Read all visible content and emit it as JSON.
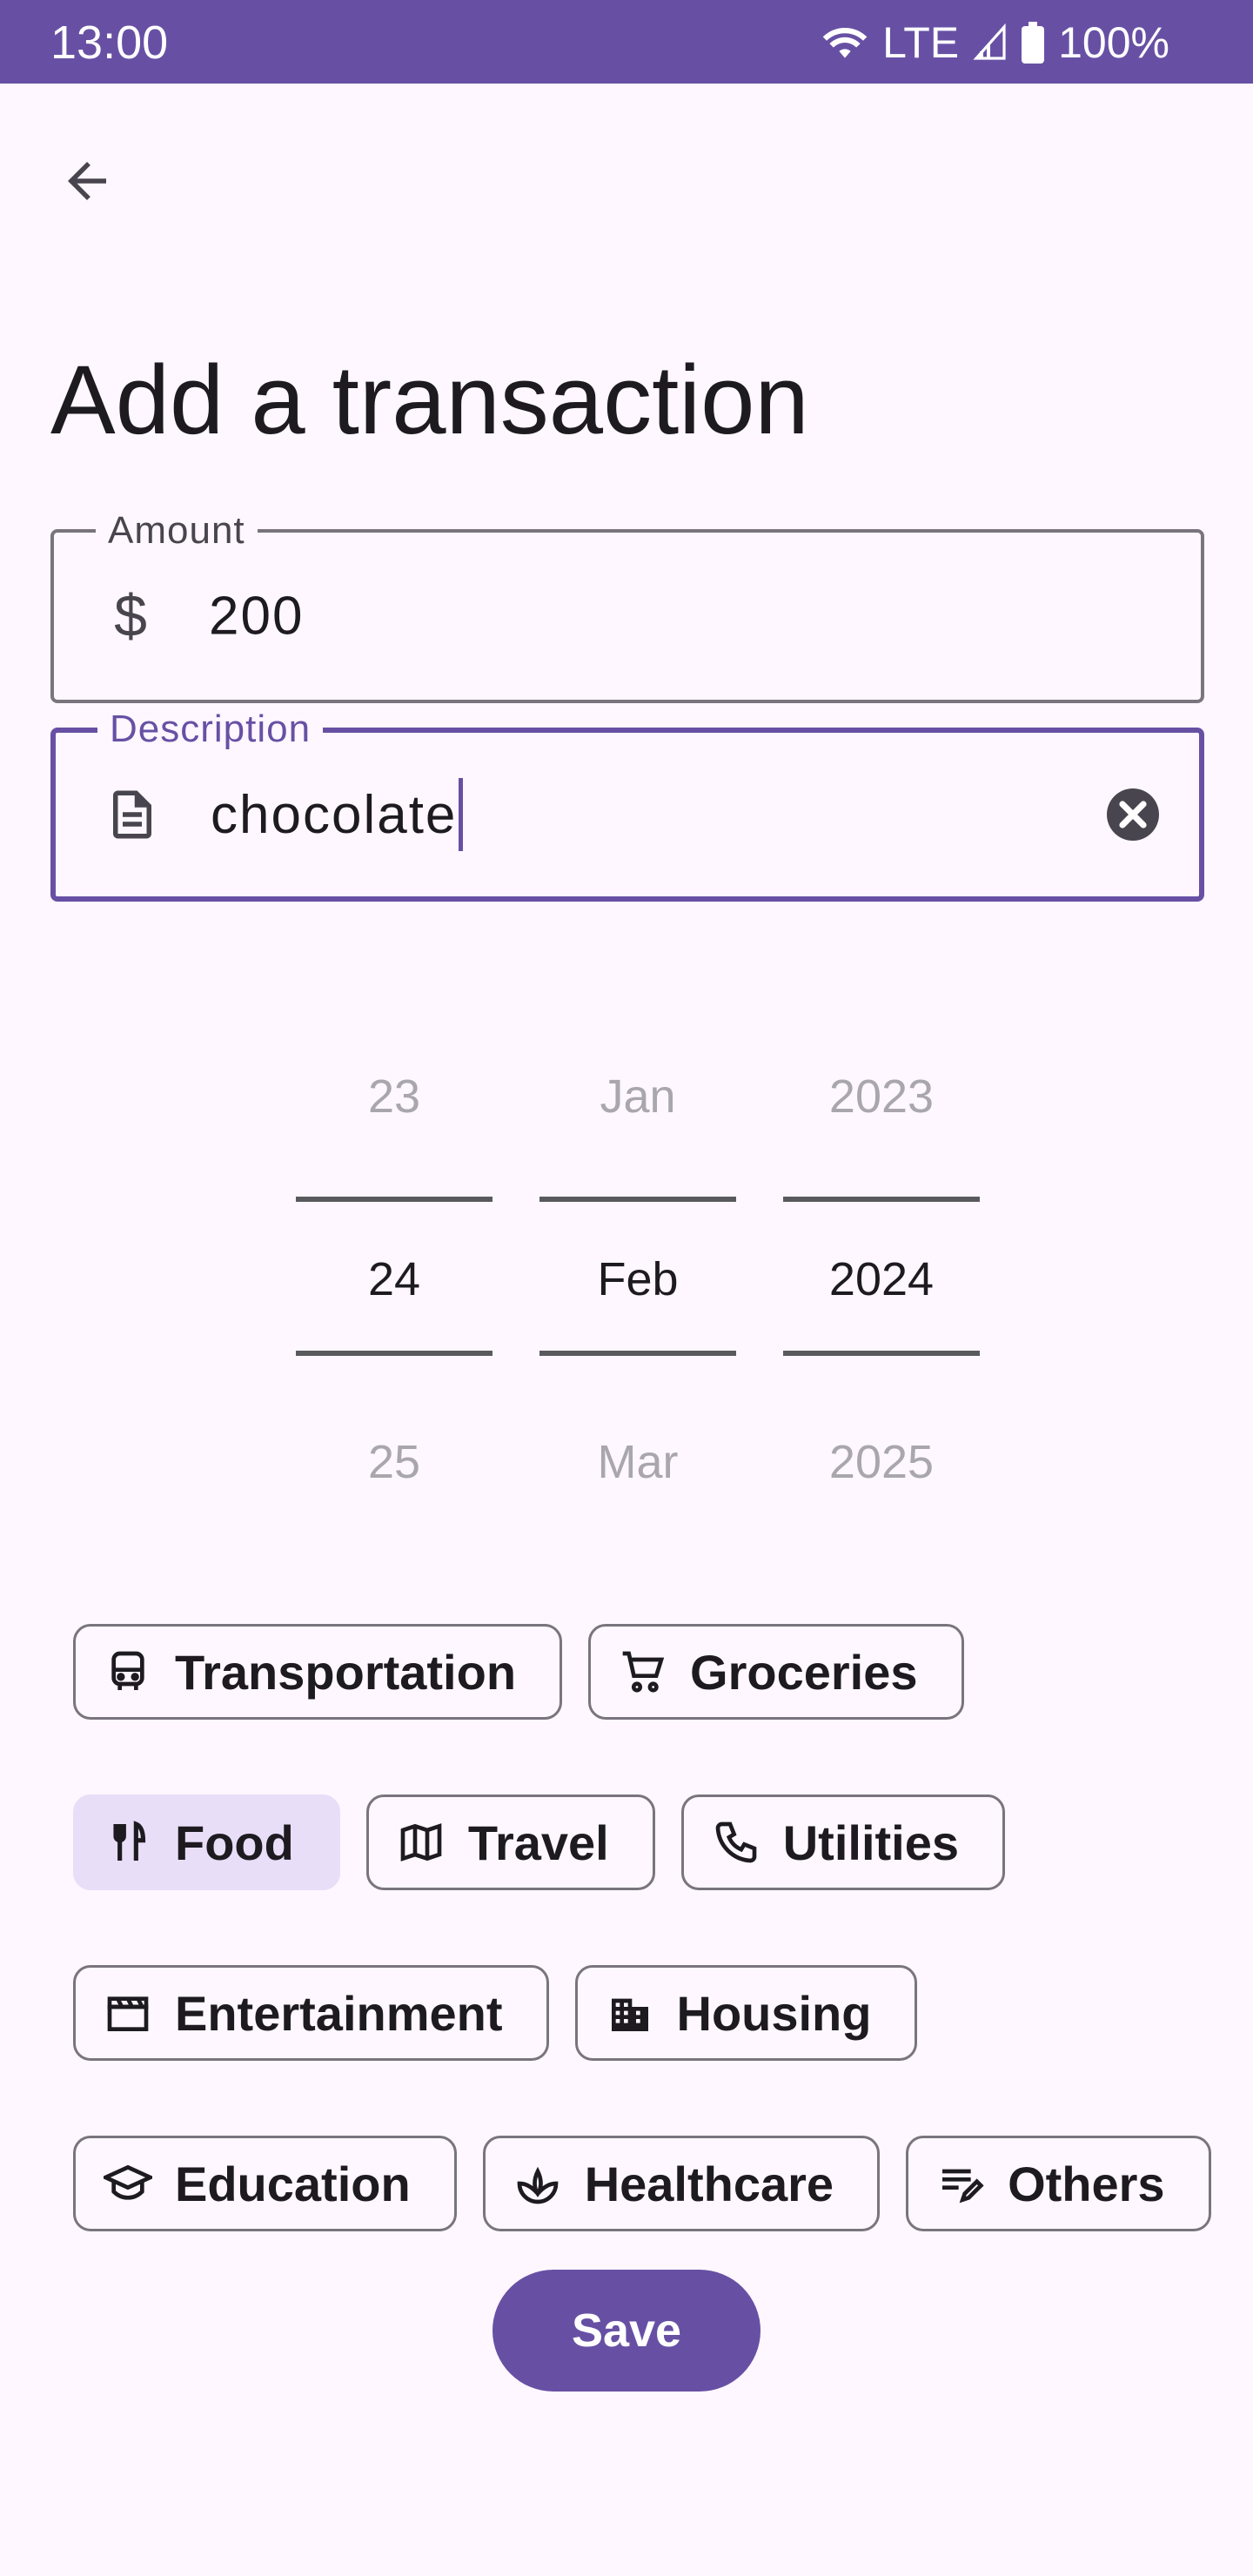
{
  "status_bar": {
    "time": "13:00",
    "network": "LTE",
    "battery": "100%"
  },
  "page": {
    "title": "Add a transaction"
  },
  "amount_field": {
    "label": "Amount",
    "currency_symbol": "$",
    "value": "200"
  },
  "description_field": {
    "label": "Description",
    "value": "chocolate"
  },
  "date_picker": {
    "day": {
      "prev": "23",
      "selected": "24",
      "next": "25"
    },
    "month": {
      "prev": "Jan",
      "selected": "Feb",
      "next": "Mar"
    },
    "year": {
      "prev": "2023",
      "selected": "2024",
      "next": "2025"
    }
  },
  "categories": [
    {
      "label": "Transportation",
      "icon": "bus-icon",
      "selected": false
    },
    {
      "label": "Groceries",
      "icon": "cart-icon",
      "selected": false
    },
    {
      "label": "Food",
      "icon": "cutlery-icon",
      "selected": true
    },
    {
      "label": "Travel",
      "icon": "map-icon",
      "selected": false
    },
    {
      "label": "Utilities",
      "icon": "phone-icon",
      "selected": false
    },
    {
      "label": "Entertainment",
      "icon": "clapperboard-icon",
      "selected": false
    },
    {
      "label": "Housing",
      "icon": "building-icon",
      "selected": false
    },
    {
      "label": "Education",
      "icon": "graduation-cap-icon",
      "selected": false
    },
    {
      "label": "Healthcare",
      "icon": "spa-icon",
      "selected": false
    },
    {
      "label": "Others",
      "icon": "notes-icon",
      "selected": false
    }
  ],
  "save_button": {
    "label": "Save"
  },
  "colors": {
    "primary": "#6750A4",
    "background": "#FEF7FF",
    "selected_chip": "#E8DEF8",
    "outline": "#79747E"
  }
}
